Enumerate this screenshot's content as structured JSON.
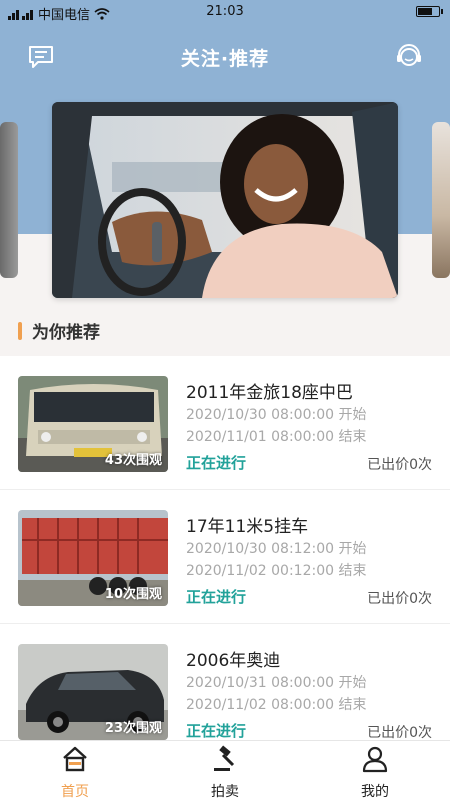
{
  "status_bar": {
    "carrier": "中国电信",
    "time": "21:03",
    "battery_level": 0.75
  },
  "nav": {
    "title": "关注·推荐",
    "left_icon": "message-icon",
    "right_icon": "customer-service-icon"
  },
  "section": {
    "title": "为你推荐"
  },
  "listings": [
    {
      "title": "2011年金旅18座中巴",
      "start": "2020/10/30 08:00:00 开始",
      "end": "2020/11/01 08:00:00 结束",
      "status": "正在进行",
      "bids": "已出价0次",
      "views": "43次围观"
    },
    {
      "title": "17年11米5挂车",
      "start": "2020/10/30 08:12:00 开始",
      "end": "2020/11/02 00:12:00 结束",
      "status": "正在进行",
      "bids": "已出价0次",
      "views": "10次围观"
    },
    {
      "title": "2006年奥迪",
      "start": "2020/10/31 08:00:00 开始",
      "end": "2020/11/02 08:00:00 结束",
      "status": "正在进行",
      "bids": "已出价0次",
      "views": "23次围观"
    }
  ],
  "tabbar": {
    "tabs": [
      {
        "label": "首页",
        "icon": "home-icon",
        "active": true
      },
      {
        "label": "拍卖",
        "icon": "auction-hammer-icon",
        "active": false
      },
      {
        "label": "我的",
        "icon": "user-icon",
        "active": false
      }
    ]
  },
  "colors": {
    "header_bg": "#8fb2d4",
    "accent": "#f0a050",
    "status_green": "#22a29a"
  }
}
